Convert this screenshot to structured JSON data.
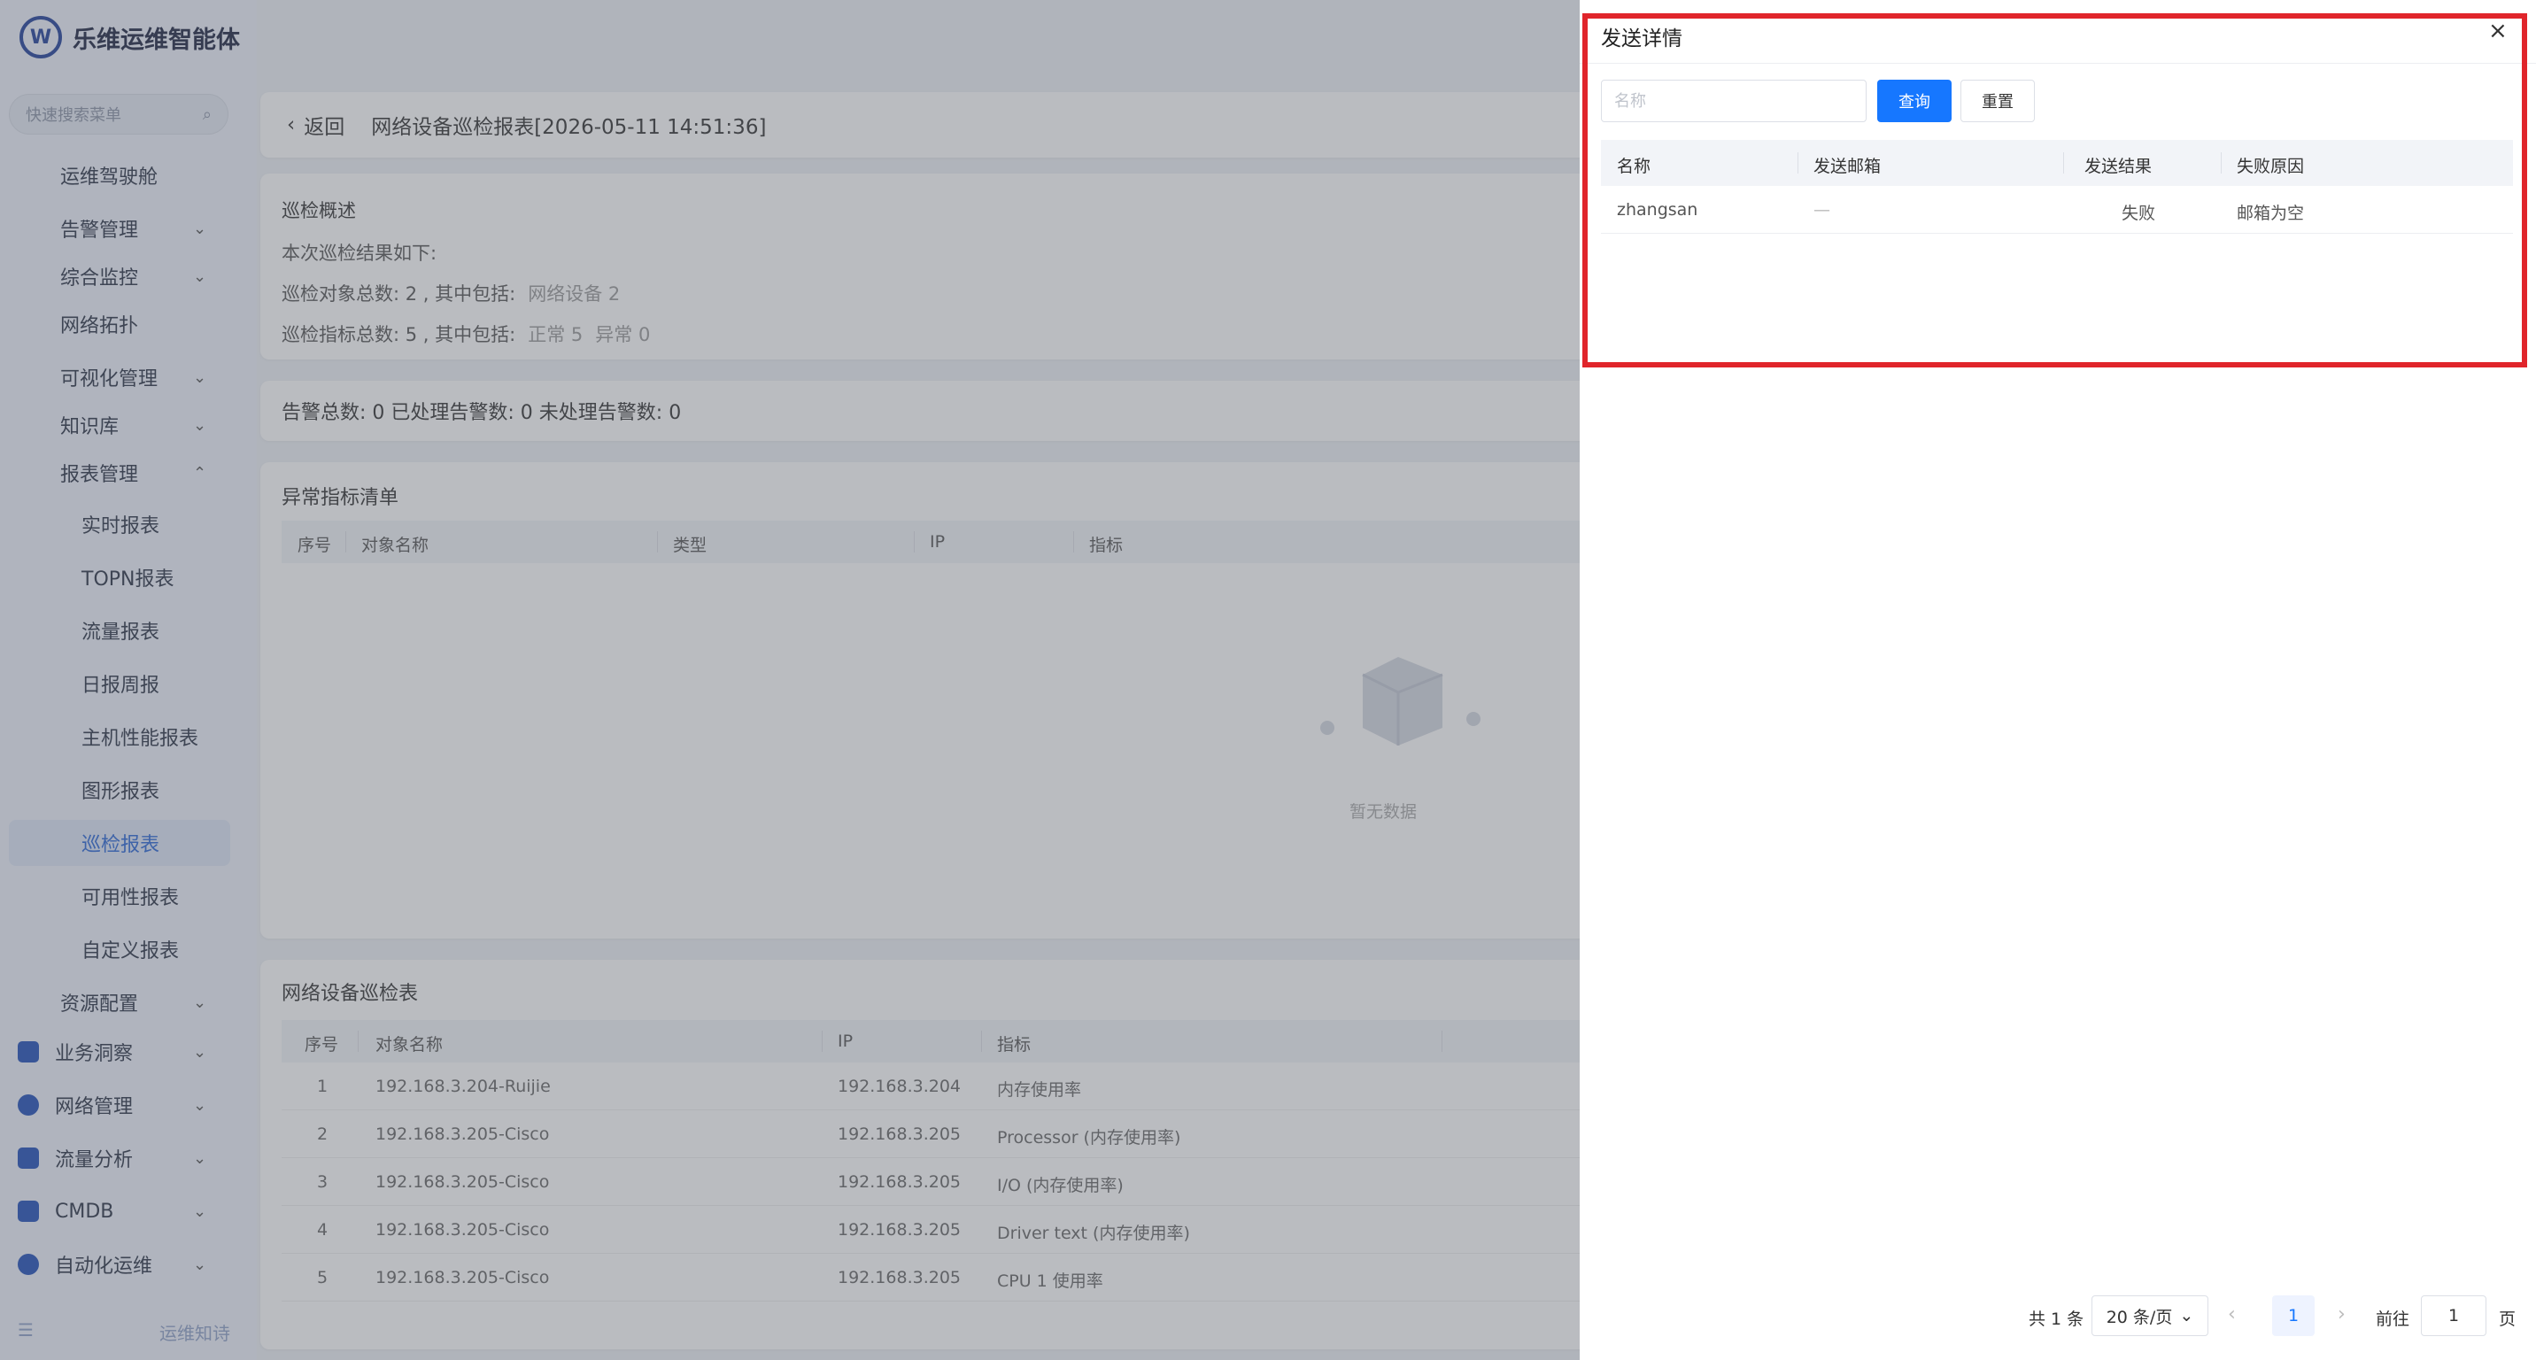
{
  "app": {
    "title": "乐维运维智能体"
  },
  "sidebar": {
    "search_placeholder": "快速搜索菜单",
    "items": [
      {
        "label": "运维驾驶舱",
        "chev": ""
      },
      {
        "label": "告警管理",
        "chev": "⌄"
      },
      {
        "label": "综合监控",
        "chev": "⌄"
      },
      {
        "label": "网络拓扑",
        "chev": ""
      },
      {
        "label": "可视化管理",
        "chev": "⌄"
      },
      {
        "label": "知识库",
        "chev": "⌄"
      },
      {
        "label": "报表管理",
        "chev": "⌃"
      },
      {
        "label": "实时报表",
        "chev": ""
      },
      {
        "label": "TOPN报表",
        "chev": ""
      },
      {
        "label": "流量报表",
        "chev": ""
      },
      {
        "label": "日报周报",
        "chev": ""
      },
      {
        "label": "主机性能报表",
        "chev": ""
      },
      {
        "label": "图形报表",
        "chev": ""
      },
      {
        "label": "巡检报表",
        "chev": ""
      },
      {
        "label": "可用性报表",
        "chev": ""
      },
      {
        "label": "自定义报表",
        "chev": ""
      },
      {
        "label": "资源配置",
        "chev": "⌄"
      },
      {
        "label": "业务洞察",
        "chev": "⌄"
      },
      {
        "label": "网络管理",
        "chev": "⌄"
      },
      {
        "label": "流量分析",
        "chev": "⌄"
      },
      {
        "label": "CMDB",
        "chev": "⌄"
      },
      {
        "label": "自动化运维",
        "chev": "⌄"
      }
    ],
    "bottom_label": "运维知诗"
  },
  "breadcrumb": {
    "back": "返回",
    "title": "网络设备巡检报表[2026-05-11 14:51:36]"
  },
  "overview": {
    "title": "巡检概述",
    "line1": "本次巡检结果如下:",
    "line2": "巡检对象总数: 2 , 其中包括:",
    "line2_muted": "网络设备 2",
    "line3": "巡检指标总数: 5 , 其中包括:",
    "line3_normal": "正常 5",
    "line3_abnormal": "异常 0"
  },
  "alarm_summary": "告警总数: 0 已处理告警数: 0 未处理告警数: 0",
  "abnormal": {
    "title": "异常指标清单",
    "columns": [
      "序号",
      "对象名称",
      "类型",
      "IP",
      "指标"
    ],
    "empty": "暂无数据"
  },
  "net_table": {
    "title": "网络设备巡检表",
    "columns": [
      "序号",
      "对象名称",
      "IP",
      "指标"
    ],
    "rows": [
      {
        "no": "1",
        "name": "192.168.3.204-Ruijie",
        "ip": "192.168.3.204",
        "metric": "内存使用率"
      },
      {
        "no": "2",
        "name": "192.168.3.205-Cisco",
        "ip": "192.168.3.205",
        "metric": "Processor (内存使用率)"
      },
      {
        "no": "3",
        "name": "192.168.3.205-Cisco",
        "ip": "192.168.3.205",
        "metric": "I/O (内存使用率)"
      },
      {
        "no": "4",
        "name": "192.168.3.205-Cisco",
        "ip": "192.168.3.205",
        "metric": "Driver text (内存使用率)"
      },
      {
        "no": "5",
        "name": "192.168.3.205-Cisco",
        "ip": "192.168.3.205",
        "metric": "CPU 1 使用率"
      }
    ]
  },
  "drawer": {
    "title": "发送详情",
    "close": "×",
    "name_placeholder": "名称",
    "query_btn": "查询",
    "reset_btn": "重置",
    "columns": [
      "名称",
      "发送邮箱",
      "发送结果",
      "失败原因"
    ],
    "rows": [
      {
        "name": "zhangsan",
        "email": "—",
        "result": "失败",
        "reason": "邮箱为空"
      }
    ],
    "pagination": {
      "total": "共 1 条",
      "page_size": "20 条/页",
      "current": "1",
      "goto_label": "前往",
      "goto_value": "1",
      "page_label": "页"
    }
  },
  "colors": {
    "primary": "#1677ff",
    "highlight_frame": "#e0252b"
  }
}
